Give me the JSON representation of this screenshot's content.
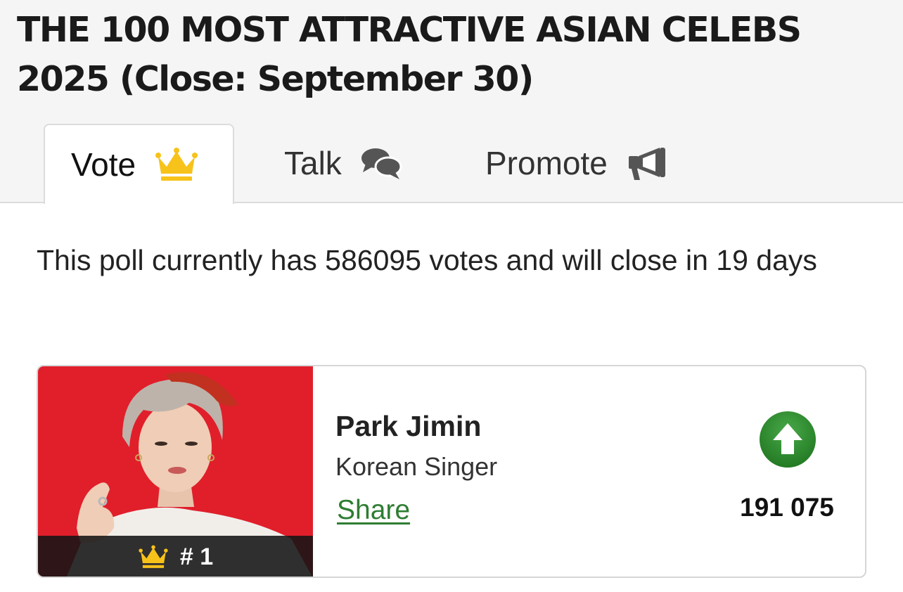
{
  "page": {
    "title": "THE 100 MOST ATTRACTIVE ASIAN CELEBS 2025 (Close: September 30)"
  },
  "tabs": [
    {
      "label": "Vote",
      "icon": "crown-icon",
      "active": true
    },
    {
      "label": "Talk",
      "icon": "chat-bubbles-icon",
      "active": false
    },
    {
      "label": "Promote",
      "icon": "megaphone-icon",
      "active": false
    }
  ],
  "poll": {
    "info": "This poll currently has 586095 votes and will close in 19 days"
  },
  "entry": {
    "rank": "# 1",
    "name": "Park Jimin",
    "category": "Korean Singer",
    "share_label": "Share",
    "votes": "191 075",
    "vote_icon": "upvote-arrow-icon"
  },
  "colors": {
    "crown": "#f7c21a",
    "share_link": "#2e7d32",
    "vote_button": "#2e8b2e",
    "photo_background": "#e8232f"
  }
}
